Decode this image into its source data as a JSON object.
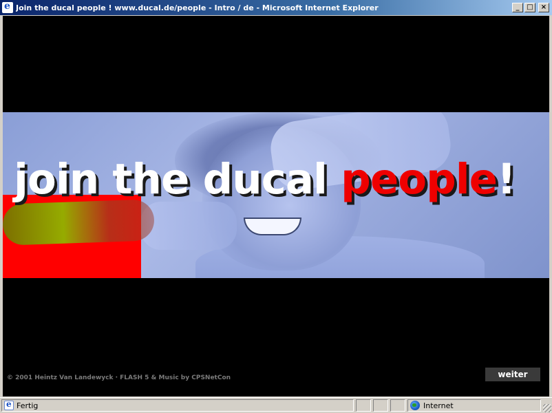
{
  "window": {
    "title": "Join the ducal people ! www.ducal.de/people - Intro / de - Microsoft Internet Explorer",
    "controls": {
      "minimize": "_",
      "maximize": "□",
      "close": "×"
    }
  },
  "banner": {
    "headline_white": "join the ducal ",
    "headline_red": "people",
    "headline_end": "!",
    "colors": {
      "background": "#8a9ed6",
      "accent_red": "#ee0000",
      "block_red": "#ff0000"
    }
  },
  "footer": {
    "copyright": "© 2001 Heintz Van Landewyck · FLASH 5 & Music by CPSNetCon",
    "weiter_label": "weiter"
  },
  "statusbar": {
    "status_text": "Fertig",
    "zone_text": "Internet"
  },
  "icons": [
    "ie-icon",
    "page-icon",
    "globe-icon",
    "resize-grip-icon"
  ]
}
